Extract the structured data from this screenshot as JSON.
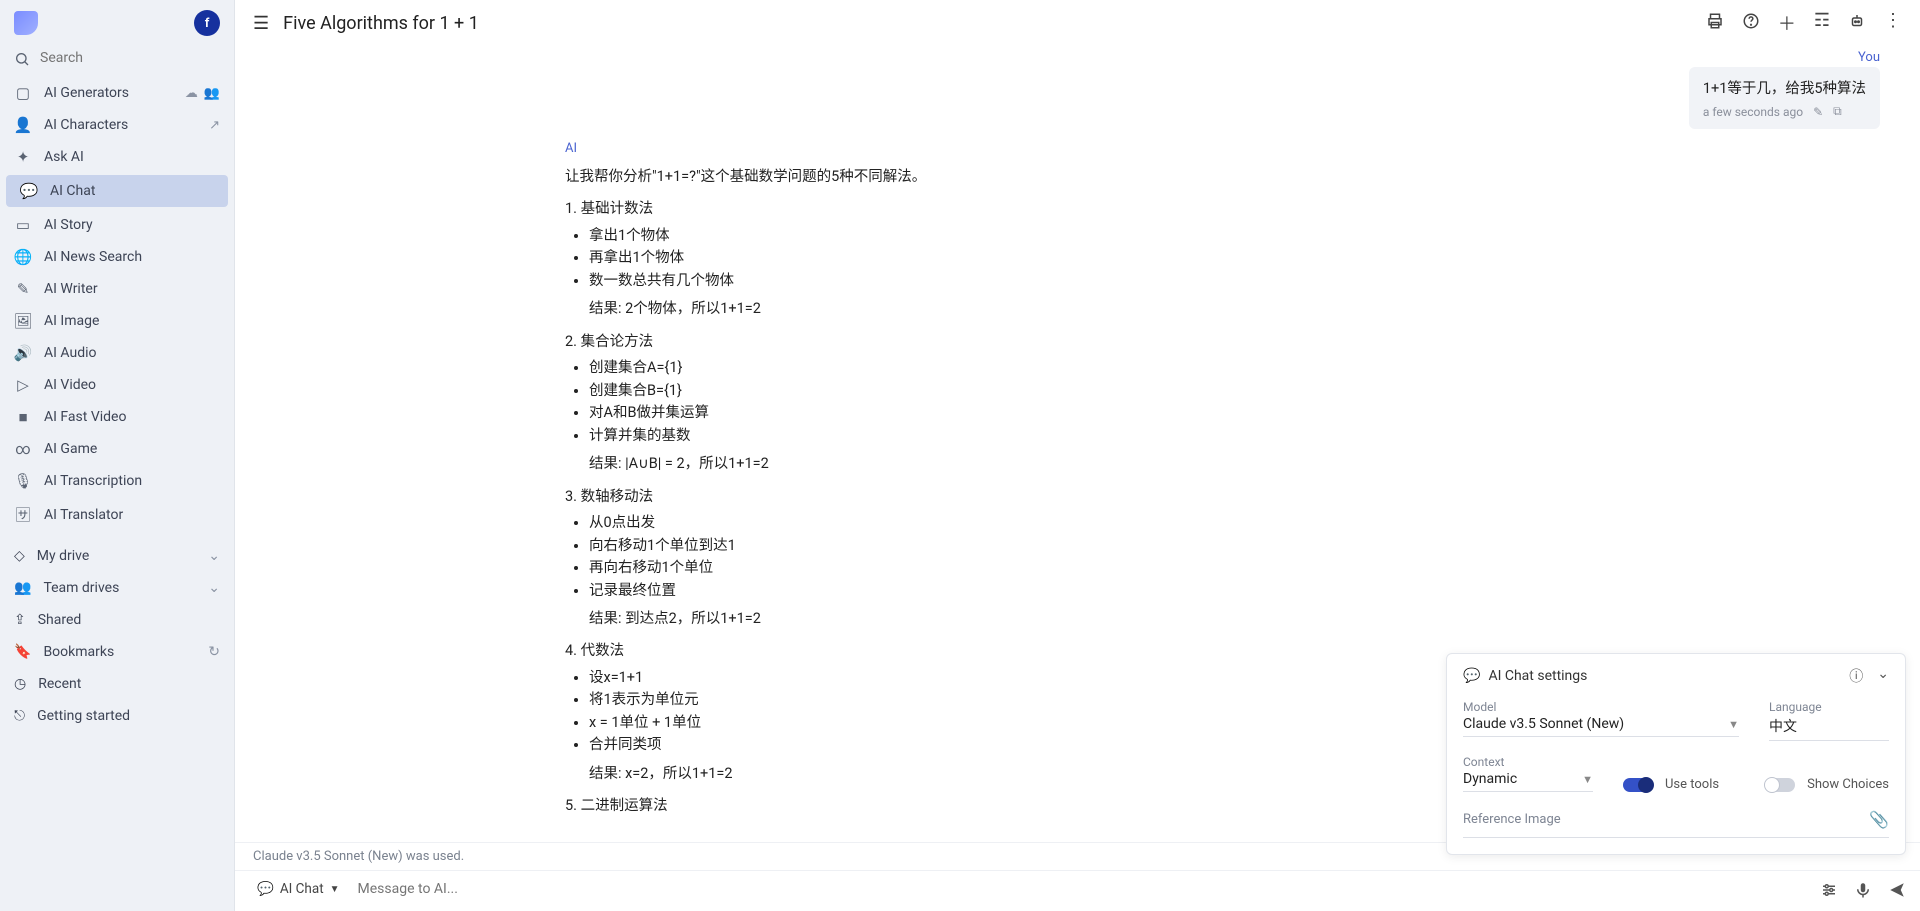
{
  "header": {
    "title": "Five Algorithms for 1 + 1"
  },
  "avatar_letter": "f",
  "search": {
    "placeholder": "Search"
  },
  "sidebar": {
    "generators": "AI Generators",
    "characters": "AI Characters",
    "ask": "Ask AI",
    "tools": [
      {
        "label": "AI Chat",
        "icon": "chat",
        "active": true
      },
      {
        "label": "AI Story",
        "icon": "book"
      },
      {
        "label": "AI News Search",
        "icon": "globe"
      },
      {
        "label": "AI Writer",
        "icon": "pencil"
      },
      {
        "label": "AI Image",
        "icon": "image"
      },
      {
        "label": "AI Audio",
        "icon": "volume"
      },
      {
        "label": "AI Video",
        "icon": "play"
      },
      {
        "label": "AI Fast Video",
        "icon": "camera"
      },
      {
        "label": "AI Game",
        "icon": "game"
      },
      {
        "label": "AI Transcription",
        "icon": "mic"
      },
      {
        "label": "AI Translator",
        "icon": "translate"
      }
    ],
    "sections": [
      {
        "label": "My drive",
        "icon": "drive",
        "chev": true
      },
      {
        "label": "Team drives",
        "icon": "team",
        "chev": true
      },
      {
        "label": "Shared",
        "icon": "share"
      },
      {
        "label": "Bookmarks",
        "icon": "bookmark",
        "tail": "↻"
      },
      {
        "label": "Recent",
        "icon": "clock"
      },
      {
        "label": "Getting started",
        "icon": "exit"
      }
    ]
  },
  "chat": {
    "you_label": "You",
    "user_msg": "1+1等于几，给我5种算法",
    "user_time": "a few seconds ago",
    "ai_label": "AI",
    "intro": "让我帮你分析\"1+1=?\"这个基础数学问题的5种不同解法。",
    "m1": {
      "h": "1. 基础计数法",
      "b": [
        "拿出1个物体",
        "再拿出1个物体",
        "数一数总共有几个物体"
      ],
      "r": "结果: 2个物体，所以1+1=2"
    },
    "m2": {
      "h": "2. 集合论方法",
      "b": [
        "创建集合A={1}",
        "创建集合B={1}",
        "对A和B做并集运算",
        "计算并集的基数"
      ],
      "r": "结果: |A∪B| = 2，所以1+1=2"
    },
    "m3": {
      "h": "3. 数轴移动法",
      "b": [
        "从0点出发",
        "向右移动1个单位到达1",
        "再向右移动1个单位",
        "记录最终位置"
      ],
      "r": "结果: 到达点2，所以1+1=2"
    },
    "m4": {
      "h": "4. 代数法",
      "b": [
        "设x=1+1",
        "将1表示为单位元",
        "x = 1单位 + 1单位",
        "合并同类项"
      ],
      "r": "结果: x=2，所以1+1=2"
    },
    "m5": {
      "h": "5. 二进制运算法"
    }
  },
  "status_line": "Claude v3.5 Sonnet (New) was used.",
  "input": {
    "chip": "AI Chat",
    "placeholder": "Message to AI..."
  },
  "settings": {
    "title": "AI Chat settings",
    "model_label": "Model",
    "model_value": "Claude v3.5 Sonnet (New)",
    "lang_label": "Language",
    "lang_value": "中文",
    "context_label": "Context",
    "context_value": "Dynamic",
    "use_tools": "Use tools",
    "show_choices": "Show Choices",
    "ref_image": "Reference Image"
  }
}
